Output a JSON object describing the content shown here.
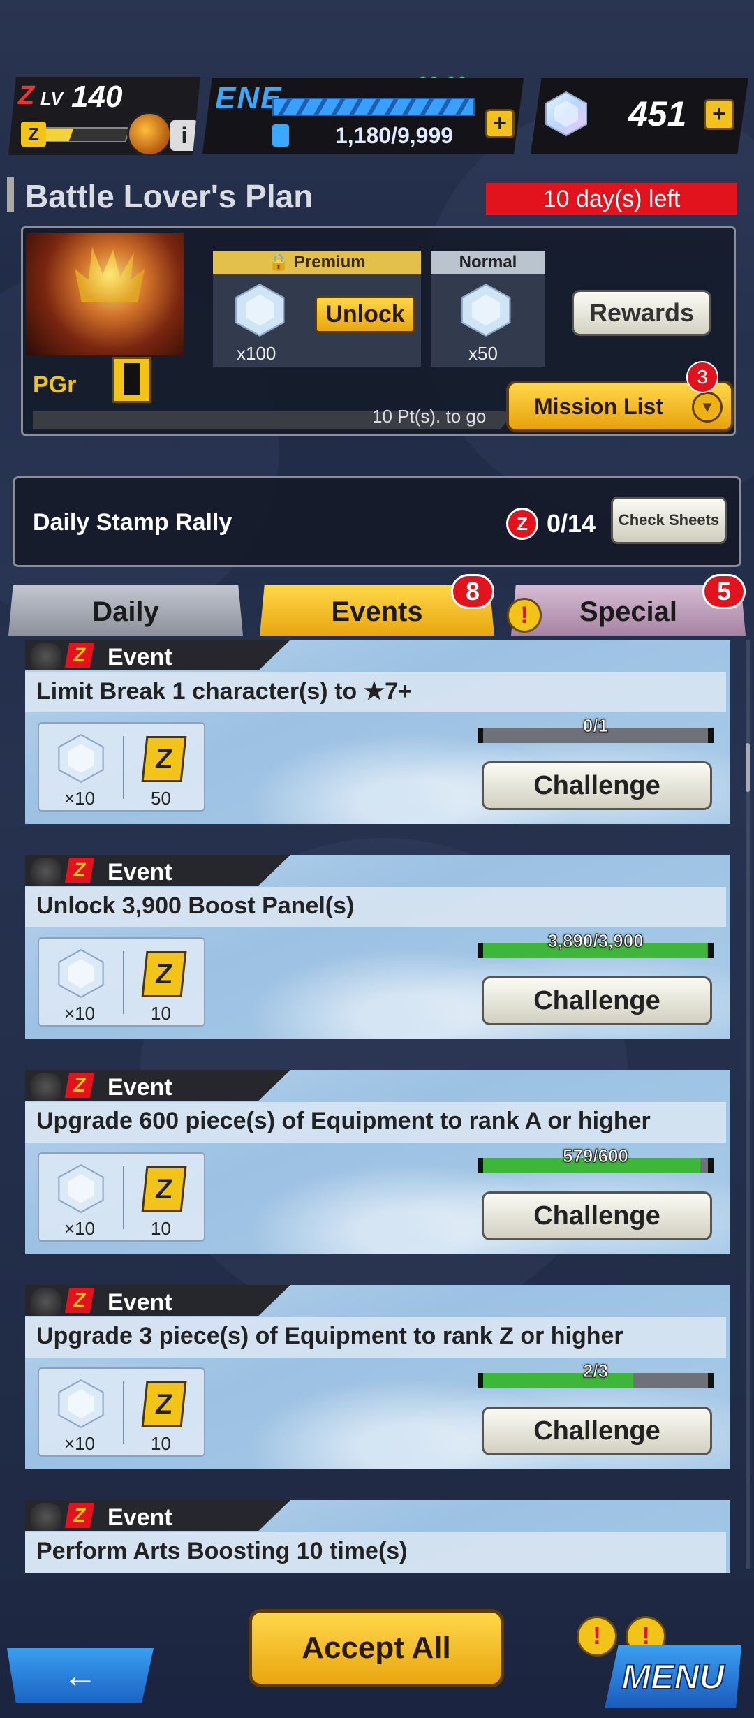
{
  "status": {
    "level_label": "LV",
    "level": "140",
    "energy_label": "ENE",
    "energy_timer": "00:00",
    "energy": "1,180/9,999",
    "gems": "451",
    "plus": "+"
  },
  "plan": {
    "title": "Battle Lover's Plan",
    "days_left": "10 day(s) left",
    "pgr_label": "PGr",
    "pgr_level": "0",
    "pts_to_go": "10 Pt(s). to go",
    "premium": {
      "label": "Premium",
      "qty": "x100"
    },
    "normal": {
      "label": "Normal",
      "qty": "x50"
    },
    "unlock_label": "Unlock",
    "rewards_label": "Rewards",
    "mission_list_label": "Mission List",
    "mission_badge": "3"
  },
  "stamp": {
    "title": "Daily Stamp Rally",
    "icon": "Z",
    "count": "0/14",
    "check_label": "Check Sheets"
  },
  "tabs": [
    {
      "label": "Daily",
      "badge": ""
    },
    {
      "label": "Events",
      "badge": "8"
    },
    {
      "label": "Special",
      "badge": "5"
    }
  ],
  "missions": [
    {
      "tag": "Event",
      "title": "Limit Break 1 character(s) to ★7+",
      "gem_qty": "×10",
      "ticket_qty": "50",
      "progress_text": "0/1",
      "progress": 0.0,
      "button": "Challenge"
    },
    {
      "tag": "Event",
      "title": "Unlock 3,900 Boost Panel(s)",
      "gem_qty": "×10",
      "ticket_qty": "10",
      "progress_text": "3,890/3,900",
      "progress": 0.997,
      "button": "Challenge"
    },
    {
      "tag": "Event",
      "title": "Upgrade 600 piece(s) of Equipment to rank A or higher",
      "gem_qty": "×10",
      "ticket_qty": "10",
      "progress_text": "579/600",
      "progress": 0.965,
      "button": "Challenge"
    },
    {
      "tag": "Event",
      "title": "Upgrade 3 piece(s) of Equipment to rank Z or higher",
      "gem_qty": "×10",
      "ticket_qty": "10",
      "progress_text": "2/3",
      "progress": 0.667,
      "button": "Challenge"
    },
    {
      "tag": "Event",
      "title": "Perform Arts Boosting 10 time(s)",
      "gem_qty": "",
      "ticket_qty": "",
      "progress_text": "",
      "progress": 0,
      "button": ""
    }
  ],
  "ticket_letter": "Z",
  "footer": {
    "back_label": "←",
    "accept_all_label": "Accept All",
    "menu_label": "MENU",
    "alert_mark": "!"
  },
  "colors": {
    "accent_gold": "#f2c418",
    "alert_red": "#e3131e",
    "progress_green": "#3eb63a",
    "energy_blue": "#3aa8ff"
  }
}
